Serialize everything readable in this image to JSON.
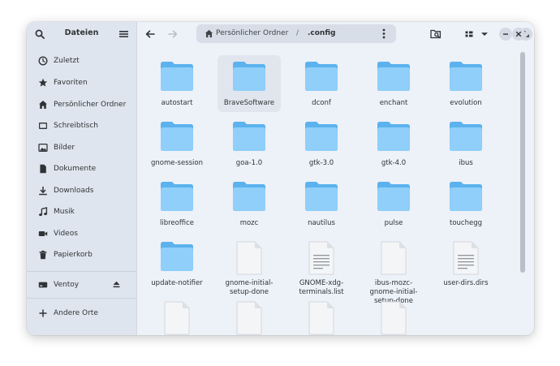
{
  "sidebar": {
    "title": "Dateien",
    "places": [
      {
        "label": "Zuletzt",
        "icon": "clock-icon"
      },
      {
        "label": "Favoriten",
        "icon": "star-icon"
      },
      {
        "label": "Persönlicher Ordner",
        "icon": "home-icon"
      },
      {
        "label": "Schreibtisch",
        "icon": "desktop-icon"
      },
      {
        "label": "Bilder",
        "icon": "image-icon"
      },
      {
        "label": "Dokumente",
        "icon": "document-icon"
      },
      {
        "label": "Downloads",
        "icon": "download-icon"
      },
      {
        "label": "Musik",
        "icon": "music-icon"
      },
      {
        "label": "Videos",
        "icon": "video-icon"
      },
      {
        "label": "Papierkorb",
        "icon": "trash-icon"
      }
    ],
    "devices": [
      {
        "label": "Ventoy",
        "icon": "drive-icon"
      }
    ],
    "other": {
      "label": "Andere Orte",
      "icon": "plus-icon"
    }
  },
  "pathbar": {
    "home_label": "Persönlicher Ordner",
    "separator": "/",
    "current": ".config"
  },
  "files": [
    {
      "name": "autostart",
      "type": "folder"
    },
    {
      "name": "BraveSoftware",
      "type": "folder",
      "selected": true
    },
    {
      "name": "dconf",
      "type": "folder"
    },
    {
      "name": "enchant",
      "type": "folder"
    },
    {
      "name": "evolution",
      "type": "folder"
    },
    {
      "name": "gnome-session",
      "type": "folder"
    },
    {
      "name": "goa-1.0",
      "type": "folder"
    },
    {
      "name": "gtk-3.0",
      "type": "folder"
    },
    {
      "name": "gtk-4.0",
      "type": "folder"
    },
    {
      "name": "ibus",
      "type": "folder"
    },
    {
      "name": "libreoffice",
      "type": "folder"
    },
    {
      "name": "mozc",
      "type": "folder"
    },
    {
      "name": "nautilus",
      "type": "folder"
    },
    {
      "name": "pulse",
      "type": "folder"
    },
    {
      "name": "touchegg",
      "type": "folder"
    },
    {
      "name": "update-notifier",
      "type": "folder"
    },
    {
      "name": "gnome-initial-setup-done",
      "type": "file"
    },
    {
      "name": "GNOME-xdg-terminals.list",
      "type": "text"
    },
    {
      "name": "ibus-mozc-gnome-initial-setup-done",
      "type": "file"
    },
    {
      "name": "user-dirs.dirs",
      "type": "text"
    },
    {
      "name": "",
      "type": "file"
    },
    {
      "name": "",
      "type": "file"
    },
    {
      "name": "",
      "type": "file"
    },
    {
      "name": "",
      "type": "file"
    }
  ],
  "colors": {
    "folder_back": "#5bb2ee",
    "folder_front": "#8fcff9",
    "sidebar_bg": "#dfe5ee",
    "content_bg": "#edf1f8"
  }
}
